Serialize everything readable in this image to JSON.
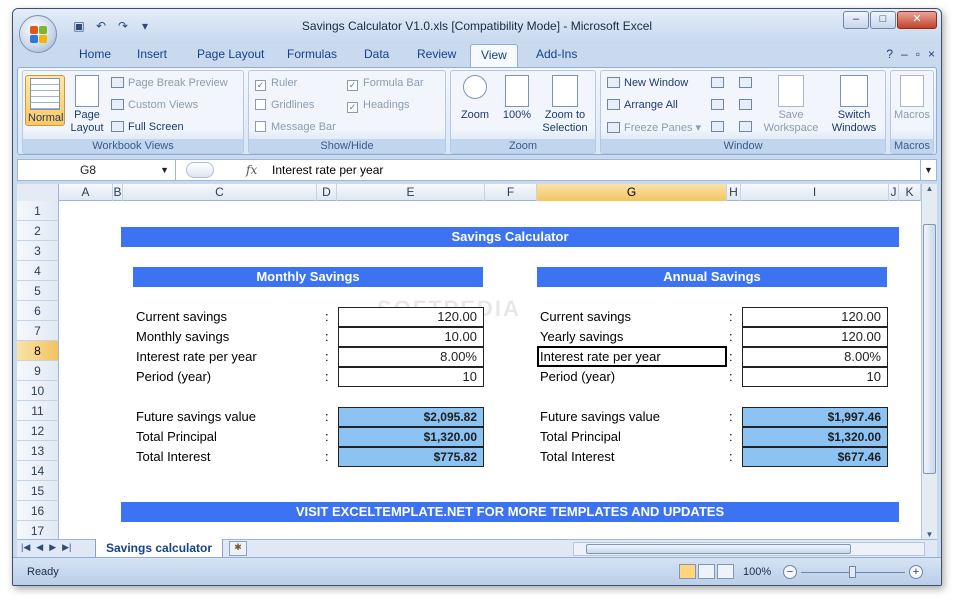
{
  "window": {
    "title": "Savings Calculator V1.0.xls  [Compatibility Mode] - Microsoft Excel",
    "controls": [
      "–",
      "□",
      "✕"
    ]
  },
  "ribbon_tabs": [
    "Home",
    "Insert",
    "Page Layout",
    "Formulas",
    "Data",
    "Review",
    "View",
    "Add-Ins"
  ],
  "active_tab": "View",
  "ribbon": {
    "workbook_views": {
      "label": "Workbook Views",
      "normal": "Normal",
      "page_layout": "Page Layout",
      "page_break_preview": "Page Break Preview",
      "custom_views": "Custom Views",
      "full_screen": "Full Screen"
    },
    "show_hide": {
      "label": "Show/Hide",
      "ruler": "Ruler",
      "formula_bar": "Formula Bar",
      "gridlines": "Gridlines",
      "headings": "Headings",
      "message_bar": "Message Bar"
    },
    "zoom": {
      "label": "Zoom",
      "zoom": "Zoom",
      "hundred": "100%",
      "zoom_to_selection": "Zoom to Selection"
    },
    "window_group": {
      "label": "Window",
      "new_window": "New Window",
      "arrange_all": "Arrange All",
      "freeze_panes": "Freeze Panes",
      "save_workspace": "Save Workspace",
      "switch_windows": "Switch Windows"
    },
    "macros": {
      "label": "Macros",
      "macros": "Macros"
    }
  },
  "formula_bar": {
    "name_box": "G8",
    "fx": "fx",
    "content": "Interest rate per year"
  },
  "columns": [
    "A",
    "B",
    "C",
    "D",
    "E",
    "F",
    "G",
    "H",
    "I",
    "J",
    "K"
  ],
  "selected_column": "G",
  "rows": [
    "1",
    "2",
    "3",
    "4",
    "5",
    "6",
    "7",
    "8",
    "9",
    "10",
    "11",
    "12",
    "13",
    "14",
    "15",
    "16",
    "17"
  ],
  "selected_row": "8",
  "sheet": {
    "title": "Savings Calculator",
    "footer": "VISIT EXCELTEMPLATE.NET FOR MORE TEMPLATES AND UPDATES",
    "monthly": {
      "header": "Monthly Savings",
      "labels": [
        "Current savings",
        "Monthly savings",
        "Interest rate per year",
        "Period (year)"
      ],
      "inputs": [
        "120.00",
        "10.00",
        "8.00%",
        "10"
      ],
      "result_labels": [
        "Future savings value",
        "Total Principal",
        "Total Interest"
      ],
      "results": [
        "$2,095.82",
        "$1,320.00",
        "$775.82"
      ]
    },
    "annual": {
      "header": "Annual Savings",
      "labels": [
        "Current savings",
        "Yearly savings",
        "Interest rate per year",
        "Period (year)"
      ],
      "inputs": [
        "120.00",
        "120.00",
        "8.00%",
        "10"
      ],
      "result_labels": [
        "Future savings value",
        "Total Principal",
        "Total Interest"
      ],
      "results": [
        "$1,997.46",
        "$1,320.00",
        "$677.46"
      ]
    },
    "colon": ":"
  },
  "sheet_tabs": [
    "Savings calculator"
  ],
  "status": {
    "ready": "Ready",
    "zoom_level": "100%",
    "zoom_minus": "−",
    "zoom_plus": "+"
  },
  "colors": {
    "band": "#3c73f2",
    "result_fill": "#8cc3f2"
  }
}
